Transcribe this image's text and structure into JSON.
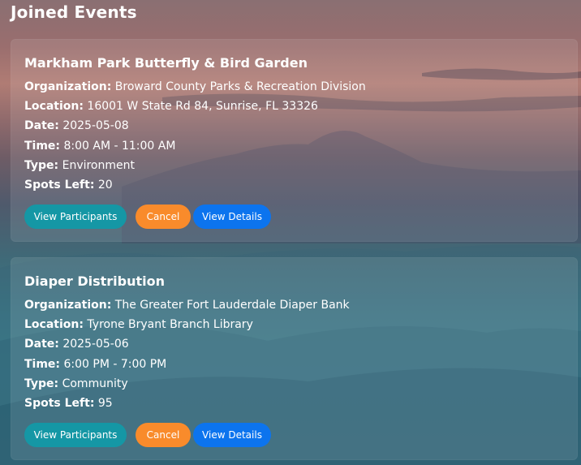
{
  "page": {
    "title": "Joined Events"
  },
  "colors": {
    "participants_button": "#1597a5",
    "cancel_button": "#f98b2b",
    "details_button": "#0c74ee"
  },
  "labels": {
    "organization": "Organization:",
    "location": "Location:",
    "date": "Date:",
    "time": "Time:",
    "type": "Type:",
    "spots_left": "Spots Left:"
  },
  "buttons": {
    "view_participants": "View Participants",
    "cancel": "Cancel",
    "view_details": "View Details"
  },
  "events": [
    {
      "title": "Markham Park Butterfly & Bird Garden",
      "organization": "Broward County Parks & Recreation Division",
      "location": "16001 W State Rd 84, Sunrise, FL 33326",
      "date": "2025-05-08",
      "time": "8:00 AM - 11:00 AM",
      "type": "Environment",
      "spots_left": "20"
    },
    {
      "title": "Diaper Distribution",
      "organization": "The Greater Fort Lauderdale Diaper Bank",
      "location": "Tyrone Bryant Branch Library",
      "date": "2025-05-06",
      "time": "6:00 PM - 7:00 PM",
      "type": "Community",
      "spots_left": "95"
    }
  ]
}
